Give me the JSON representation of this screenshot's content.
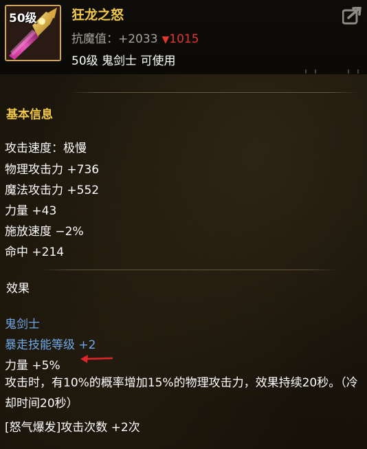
{
  "item": {
    "level_badge": "50级",
    "name": "狂龙之怒",
    "stat_label": "抗魔值：",
    "stat_value": "+2033",
    "stat_change": "1015",
    "requirement": "50级 鬼剑士 可使用"
  },
  "basic": {
    "title": "基本信息",
    "rows": [
      "攻击速度：极慢",
      "物理攻击力 +736",
      "魔法攻击力 +552",
      "力量 +43",
      "施放速度 −2%",
      "命中 +214"
    ]
  },
  "effects": {
    "title": "效果",
    "class_name": "鬼剑士",
    "skill_bonus": "暴走技能等级 +2",
    "strength": "力量 +5%",
    "proc_text": "攻击时，有10%的概率增加15%的物理攻击力，效果持续20秒。（冷却时间20秒）",
    "combo": "[怒气爆发]攻击次数 +2次"
  },
  "colors": {
    "name_gold": "#f2c84b",
    "skill_blue": "#6fa8e8",
    "decrease_red": "#e2382c",
    "annotation_arrow": "#e0262a"
  },
  "icons": [
    "sword-item-icon",
    "export-icon",
    "red-arrow-annotation"
  ]
}
